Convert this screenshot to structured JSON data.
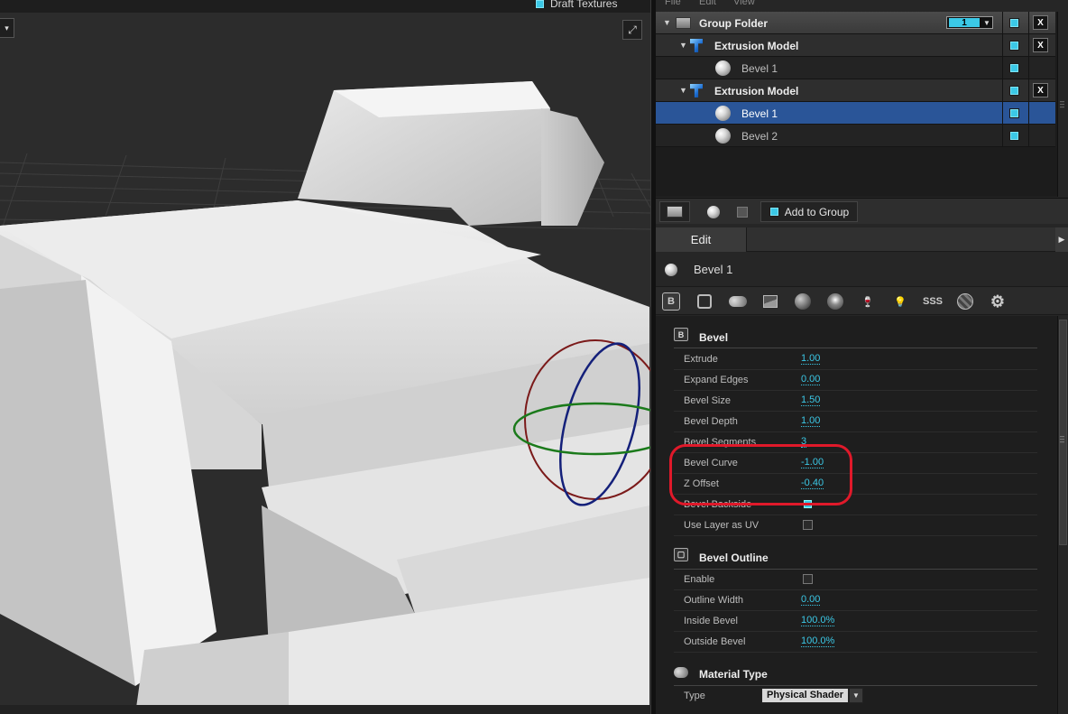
{
  "viewport": {
    "draft_textures_label": "Draft Textures",
    "dropdown_glyph": "▾",
    "maximize_glyph": "⤢"
  },
  "menu": {
    "file": "File",
    "edit": "Edit",
    "view": "View"
  },
  "tree": {
    "rows": [
      {
        "label": "Group Folder",
        "kind": "group",
        "layer": "1"
      },
      {
        "label": "Extrusion Model",
        "kind": "model"
      },
      {
        "label": "Bevel 1",
        "kind": "material"
      },
      {
        "label": "Extrusion Model",
        "kind": "model"
      },
      {
        "label": "Bevel 1",
        "kind": "material",
        "selected": true
      },
      {
        "label": "Bevel 2",
        "kind": "material"
      }
    ],
    "close_glyph": "X",
    "expand_glyph": "▼"
  },
  "toolbar": {
    "add_to_group": "Add to Group"
  },
  "edit_panel": {
    "tab_label": "Edit",
    "object_name": "Bevel 1",
    "icons": [
      "bevel-icon",
      "outline-icon",
      "material-type-icon",
      "texture-icon",
      "sphere-material-icon",
      "reflection-icon",
      "glass-icon",
      "light-icon",
      "sss-icon",
      "noise-icon",
      "settings-icon"
    ],
    "sss_text": "SSS"
  },
  "bevel_section": {
    "title": "Bevel",
    "icon_text": "B",
    "properties": [
      {
        "label": "Extrude",
        "value": "1.00"
      },
      {
        "label": "Expand Edges",
        "value": "0.00"
      },
      {
        "label": "Bevel Size",
        "value": "1.50"
      },
      {
        "label": "Bevel Depth",
        "value": "1.00"
      },
      {
        "label": "Bevel Segments",
        "value": "3"
      },
      {
        "label": "Bevel Curve",
        "value": "-1.00"
      },
      {
        "label": "Z Offset",
        "value": "-0.40"
      },
      {
        "label": "Bevel Backside",
        "checked": true
      },
      {
        "label": "Use Layer as UV",
        "checked": false
      }
    ]
  },
  "outline_section": {
    "title": "Bevel Outline",
    "properties": [
      {
        "label": "Enable",
        "checked": false
      },
      {
        "label": "Outline Width",
        "value": "0.00"
      },
      {
        "label": "Inside Bevel",
        "value": "100.0%"
      },
      {
        "label": "Outside Bevel",
        "value": "100.0%"
      }
    ]
  },
  "material_section": {
    "title": "Material Type",
    "type_label": "Type",
    "type_value": "Physical Shader"
  },
  "colors": {
    "accent": "#3bc8e6",
    "selection": "#2a5598",
    "highlight": "#e0192a"
  }
}
